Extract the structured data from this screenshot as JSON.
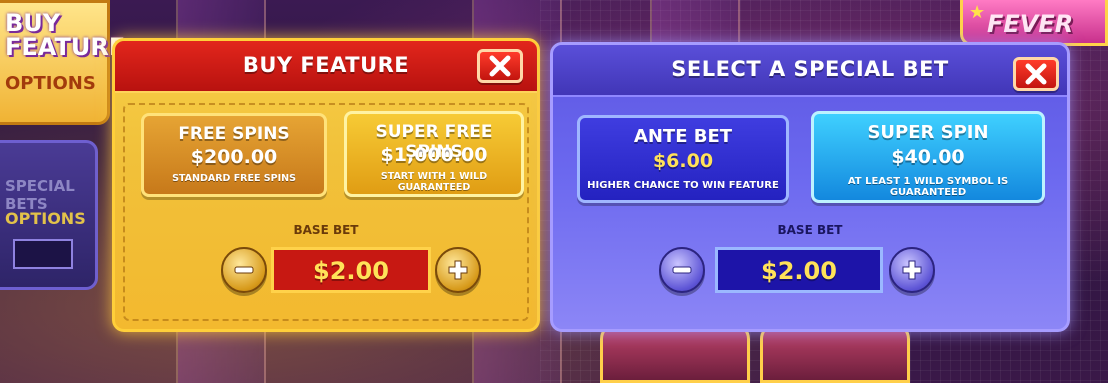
{
  "background": {
    "left_menu": {
      "title": "BUY\nFEATURE",
      "subtitle": "OPTIONS"
    },
    "left_menu2": {
      "title": "SPECIAL BETS",
      "subtitle": "OPTIONS"
    },
    "logo_text": "FEVER"
  },
  "buy_feature": {
    "title": "BUY FEATURE",
    "options": [
      {
        "name": "FREE SPINS",
        "price": "$200.00",
        "description": "STANDARD FREE SPINS"
      },
      {
        "name": "SUPER FREE SPINS",
        "price": "$1,000.00",
        "description": "START WITH 1 WILD GUARANTEED"
      }
    ],
    "base_bet_label": "BASE BET",
    "base_bet_value": "$2.00"
  },
  "special_bet": {
    "title": "SELECT A SPECIAL BET",
    "options": [
      {
        "name": "ANTE BET",
        "price": "$6.00",
        "description": "HIGHER CHANCE TO WIN FEATURE"
      },
      {
        "name": "SUPER SPIN",
        "price": "$40.00",
        "description": "AT LEAST 1 WILD SYMBOL IS GUARANTEED"
      }
    ],
    "base_bet_label": "BASE BET",
    "base_bet_value": "$2.00"
  },
  "icons": {
    "close": "close-icon",
    "minus": "minus-icon",
    "plus": "plus-icon"
  },
  "colors": {
    "buy_header": "#d01d16",
    "buy_body": "#f3c13c",
    "special_body": "#6a66ee",
    "price_yellow": "#ffe259"
  }
}
